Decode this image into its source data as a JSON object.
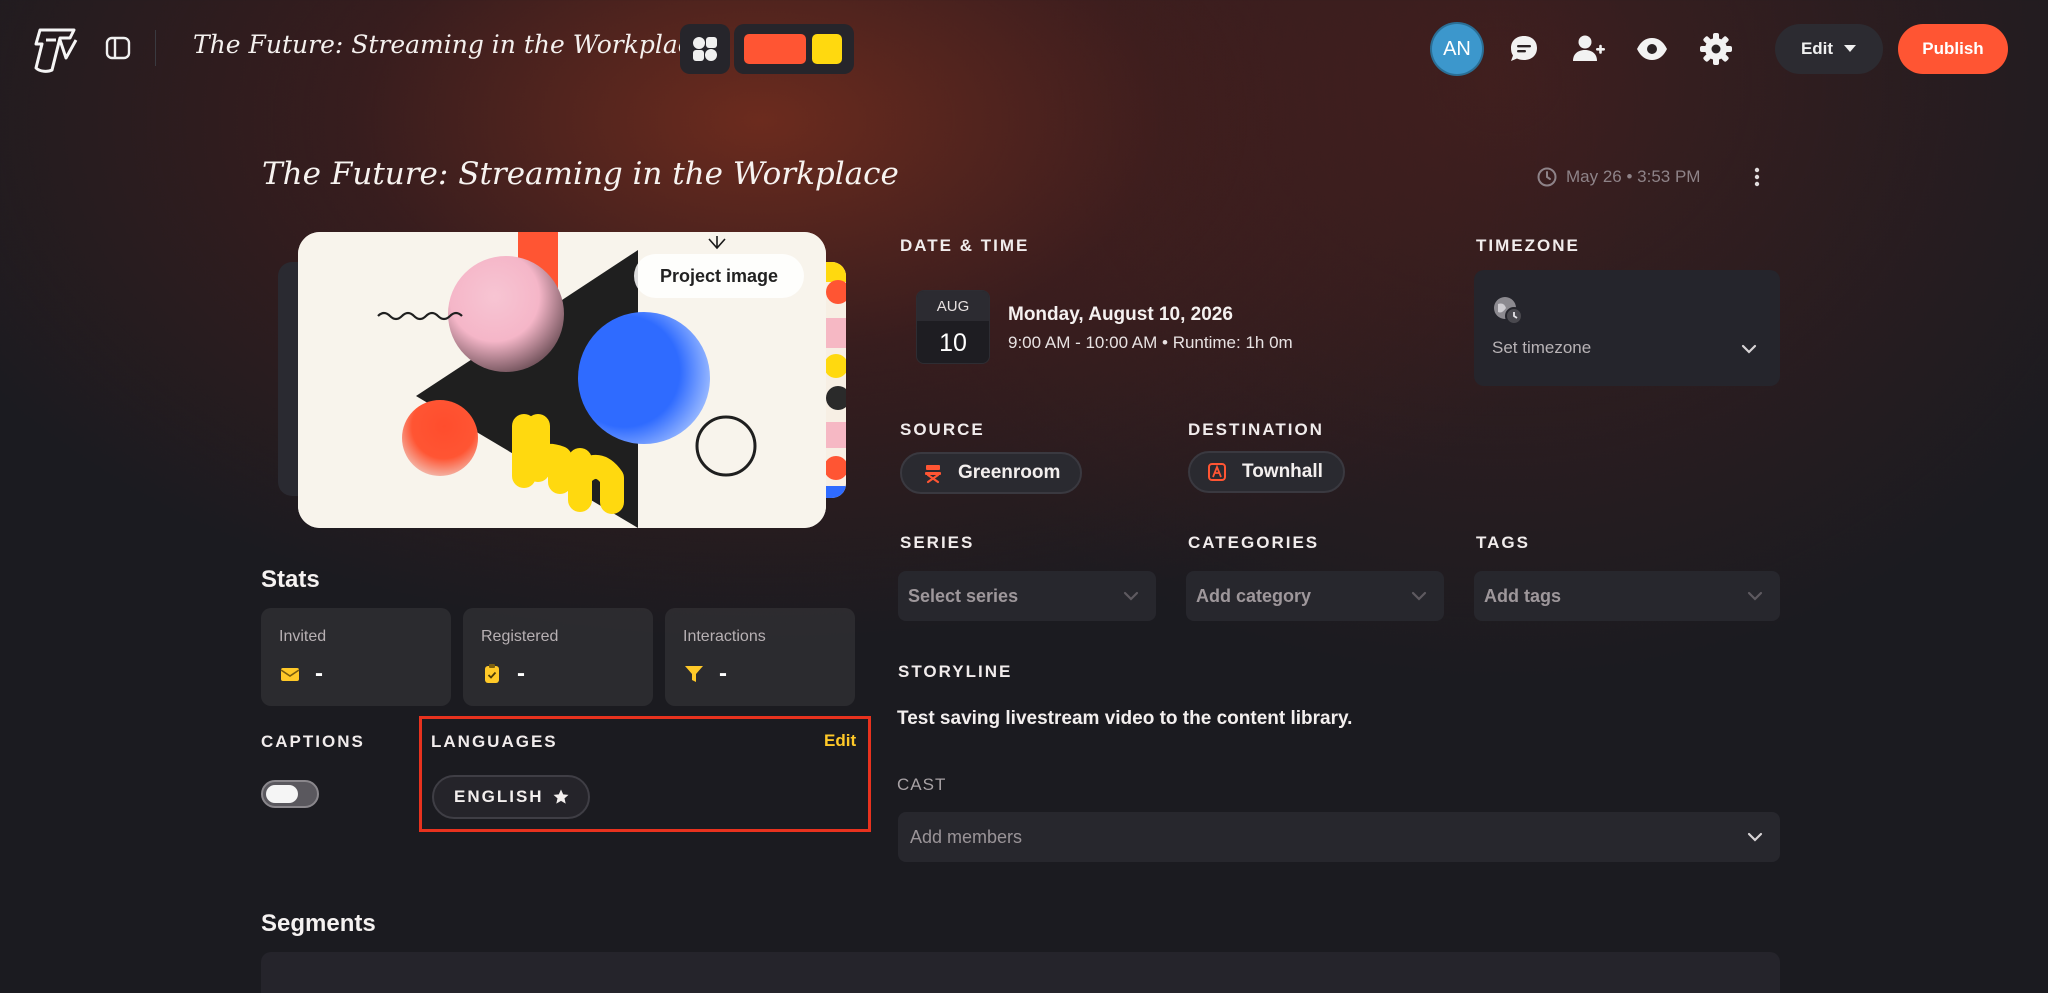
{
  "app": {
    "title": "The Future: Streaming in the Workplace",
    "logo_text": "TV"
  },
  "header": {
    "avatar_initials": "AN",
    "edit_label": "Edit",
    "publish_label": "Publish",
    "palette": {
      "primary": "#ff5533",
      "secondary": "#ffd90f"
    }
  },
  "page": {
    "title": "The Future: Streaming in the Workplace",
    "updated": "May 26 • 3:53 PM",
    "project_image_label": "Project image"
  },
  "datetime": {
    "label": "DATE & TIME",
    "month": "AUG",
    "day": "10",
    "date_text": "Monday, August 10, 2026",
    "time_text": "9:00 AM - 10:00 AM • Runtime: 1h 0m"
  },
  "timezone": {
    "label": "TIMEZONE",
    "placeholder": "Set timezone"
  },
  "source": {
    "label": "SOURCE",
    "value": "Greenroom"
  },
  "destination": {
    "label": "DESTINATION",
    "value": "Townhall"
  },
  "series": {
    "label": "SERIES",
    "placeholder": "Select series"
  },
  "categories": {
    "label": "CATEGORIES",
    "placeholder": "Add category"
  },
  "tags": {
    "label": "TAGS",
    "placeholder": "Add tags"
  },
  "stats": {
    "title": "Stats",
    "items": [
      {
        "label": "Invited",
        "value": "-",
        "icon": "envelope-icon"
      },
      {
        "label": "Registered",
        "value": "-",
        "icon": "clipboard-check-icon"
      },
      {
        "label": "Interactions",
        "value": "-",
        "icon": "funnel-icon"
      }
    ]
  },
  "captions": {
    "label": "CAPTIONS",
    "enabled": false
  },
  "languages": {
    "label": "LANGUAGES",
    "edit_label": "Edit",
    "items": [
      {
        "label": "ENGLISH",
        "primary": true
      }
    ]
  },
  "storyline": {
    "label": "STORYLINE",
    "text": "Test saving livestream video to the content library."
  },
  "cast": {
    "label": "CAST",
    "placeholder": "Add members"
  },
  "segments": {
    "title": "Segments"
  }
}
